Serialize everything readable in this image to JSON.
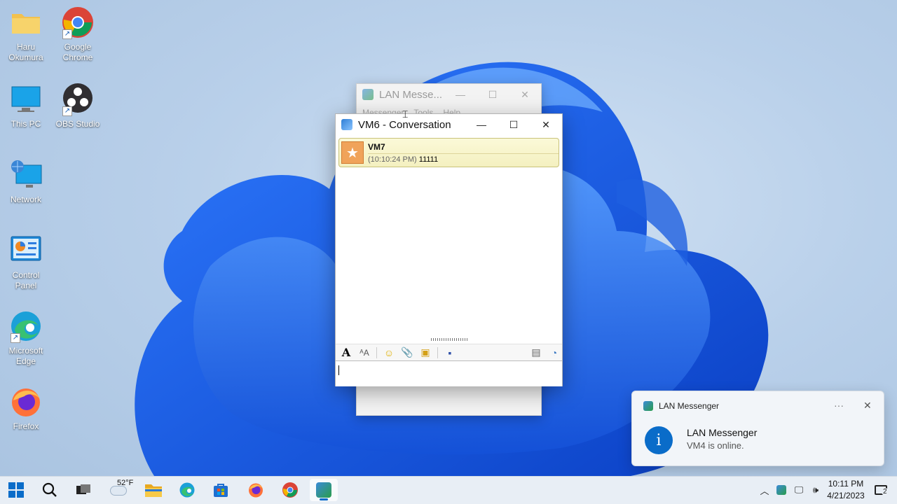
{
  "desktop": {
    "icons": [
      {
        "label": "Haru Okumura"
      },
      {
        "label": "Google Chrome"
      },
      {
        "label": "This PC"
      },
      {
        "label": "OBS Studio"
      },
      {
        "label": "Network"
      },
      {
        "label": "Control Panel"
      },
      {
        "label": "Microsoft Edge"
      },
      {
        "label": "Firefox"
      }
    ]
  },
  "main_window": {
    "title": "LAN Messe...",
    "menu": [
      "Messenger",
      "Tools",
      "Help"
    ]
  },
  "conversation": {
    "title": "VM6 - Conversation",
    "message": {
      "sender": "VM7",
      "time": "(10:10:24 PM)",
      "text": "11111"
    }
  },
  "notification": {
    "app": "LAN Messenger",
    "title": "LAN Messenger",
    "text": "VM4 is online."
  },
  "taskbar": {
    "weather_temp": "52°F",
    "clock_time": "10:11 PM",
    "clock_date": "4/21/2023",
    "notification_count": "2"
  },
  "colors": {
    "accent": "#0a6cc9",
    "message_bg": "#f4f0c0"
  }
}
